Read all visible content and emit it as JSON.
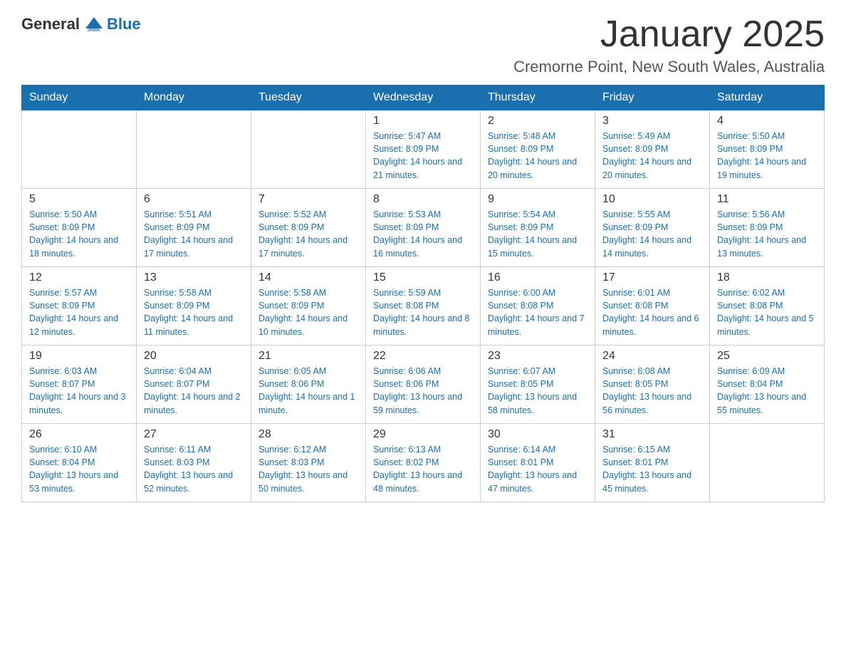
{
  "logo": {
    "general": "General",
    "blue": "Blue"
  },
  "title": "January 2025",
  "subtitle": "Cremorne Point, New South Wales, Australia",
  "headers": [
    "Sunday",
    "Monday",
    "Tuesday",
    "Wednesday",
    "Thursday",
    "Friday",
    "Saturday"
  ],
  "weeks": [
    [
      {
        "day": "",
        "info": ""
      },
      {
        "day": "",
        "info": ""
      },
      {
        "day": "",
        "info": ""
      },
      {
        "day": "1",
        "info": "Sunrise: 5:47 AM\nSunset: 8:09 PM\nDaylight: 14 hours and 21 minutes."
      },
      {
        "day": "2",
        "info": "Sunrise: 5:48 AM\nSunset: 8:09 PM\nDaylight: 14 hours and 20 minutes."
      },
      {
        "day": "3",
        "info": "Sunrise: 5:49 AM\nSunset: 8:09 PM\nDaylight: 14 hours and 20 minutes."
      },
      {
        "day": "4",
        "info": "Sunrise: 5:50 AM\nSunset: 8:09 PM\nDaylight: 14 hours and 19 minutes."
      }
    ],
    [
      {
        "day": "5",
        "info": "Sunrise: 5:50 AM\nSunset: 8:09 PM\nDaylight: 14 hours and 18 minutes."
      },
      {
        "day": "6",
        "info": "Sunrise: 5:51 AM\nSunset: 8:09 PM\nDaylight: 14 hours and 17 minutes."
      },
      {
        "day": "7",
        "info": "Sunrise: 5:52 AM\nSunset: 8:09 PM\nDaylight: 14 hours and 17 minutes."
      },
      {
        "day": "8",
        "info": "Sunrise: 5:53 AM\nSunset: 8:09 PM\nDaylight: 14 hours and 16 minutes."
      },
      {
        "day": "9",
        "info": "Sunrise: 5:54 AM\nSunset: 8:09 PM\nDaylight: 14 hours and 15 minutes."
      },
      {
        "day": "10",
        "info": "Sunrise: 5:55 AM\nSunset: 8:09 PM\nDaylight: 14 hours and 14 minutes."
      },
      {
        "day": "11",
        "info": "Sunrise: 5:56 AM\nSunset: 8:09 PM\nDaylight: 14 hours and 13 minutes."
      }
    ],
    [
      {
        "day": "12",
        "info": "Sunrise: 5:57 AM\nSunset: 8:09 PM\nDaylight: 14 hours and 12 minutes."
      },
      {
        "day": "13",
        "info": "Sunrise: 5:58 AM\nSunset: 8:09 PM\nDaylight: 14 hours and 11 minutes."
      },
      {
        "day": "14",
        "info": "Sunrise: 5:58 AM\nSunset: 8:09 PM\nDaylight: 14 hours and 10 minutes."
      },
      {
        "day": "15",
        "info": "Sunrise: 5:59 AM\nSunset: 8:08 PM\nDaylight: 14 hours and 8 minutes."
      },
      {
        "day": "16",
        "info": "Sunrise: 6:00 AM\nSunset: 8:08 PM\nDaylight: 14 hours and 7 minutes."
      },
      {
        "day": "17",
        "info": "Sunrise: 6:01 AM\nSunset: 8:08 PM\nDaylight: 14 hours and 6 minutes."
      },
      {
        "day": "18",
        "info": "Sunrise: 6:02 AM\nSunset: 8:08 PM\nDaylight: 14 hours and 5 minutes."
      }
    ],
    [
      {
        "day": "19",
        "info": "Sunrise: 6:03 AM\nSunset: 8:07 PM\nDaylight: 14 hours and 3 minutes."
      },
      {
        "day": "20",
        "info": "Sunrise: 6:04 AM\nSunset: 8:07 PM\nDaylight: 14 hours and 2 minutes."
      },
      {
        "day": "21",
        "info": "Sunrise: 6:05 AM\nSunset: 8:06 PM\nDaylight: 14 hours and 1 minute."
      },
      {
        "day": "22",
        "info": "Sunrise: 6:06 AM\nSunset: 8:06 PM\nDaylight: 13 hours and 59 minutes."
      },
      {
        "day": "23",
        "info": "Sunrise: 6:07 AM\nSunset: 8:05 PM\nDaylight: 13 hours and 58 minutes."
      },
      {
        "day": "24",
        "info": "Sunrise: 6:08 AM\nSunset: 8:05 PM\nDaylight: 13 hours and 56 minutes."
      },
      {
        "day": "25",
        "info": "Sunrise: 6:09 AM\nSunset: 8:04 PM\nDaylight: 13 hours and 55 minutes."
      }
    ],
    [
      {
        "day": "26",
        "info": "Sunrise: 6:10 AM\nSunset: 8:04 PM\nDaylight: 13 hours and 53 minutes."
      },
      {
        "day": "27",
        "info": "Sunrise: 6:11 AM\nSunset: 8:03 PM\nDaylight: 13 hours and 52 minutes."
      },
      {
        "day": "28",
        "info": "Sunrise: 6:12 AM\nSunset: 8:03 PM\nDaylight: 13 hours and 50 minutes."
      },
      {
        "day": "29",
        "info": "Sunrise: 6:13 AM\nSunset: 8:02 PM\nDaylight: 13 hours and 48 minutes."
      },
      {
        "day": "30",
        "info": "Sunrise: 6:14 AM\nSunset: 8:01 PM\nDaylight: 13 hours and 47 minutes."
      },
      {
        "day": "31",
        "info": "Sunrise: 6:15 AM\nSunset: 8:01 PM\nDaylight: 13 hours and 45 minutes."
      },
      {
        "day": "",
        "info": ""
      }
    ]
  ]
}
